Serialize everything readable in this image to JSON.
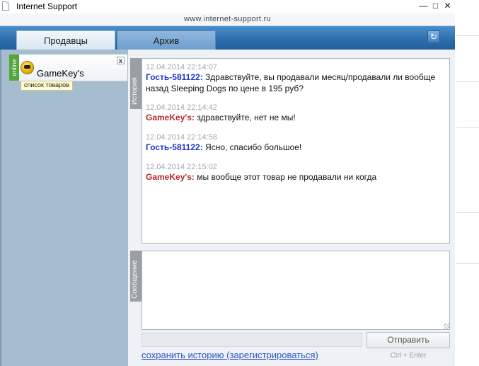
{
  "window": {
    "title": "Internet Support",
    "url": "www.internet-support.ru",
    "controls": {
      "minimize": "—",
      "maximize": "□",
      "close": "✕"
    }
  },
  "tabs": [
    {
      "label": "Продавцы",
      "active": true
    },
    {
      "label": "Архив",
      "active": false
    }
  ],
  "refresh_icon": "refresh-icon",
  "operator": {
    "status": "online",
    "name": "GameKey's",
    "products_link": "список товаров",
    "close_label": "x"
  },
  "history": {
    "label": "История",
    "messages": [
      {
        "time": "12.04.2014 22:14:07",
        "sender": "Гость-581122",
        "text": "Здравствуйте, вы продавали месяц/продавали ли вообще назад Sleeping Dogs по цене в 195 руб?",
        "role": "guest"
      },
      {
        "time": "12.04.2014 22:14:42",
        "sender": "GameKey's",
        "text": "здравствуйте, нет не мы!",
        "role": "operator"
      },
      {
        "time": "12.04.2014 22:14:58",
        "sender": "Гость-581122",
        "text": "Ясно, спасибо большое!",
        "role": "guest"
      },
      {
        "time": "12.04.2014 22:15:02",
        "sender": "GameKey's",
        "text": "мы вообще этот товар не продавали ни когда",
        "role": "operator"
      }
    ]
  },
  "compose": {
    "label": "Сообщение",
    "value": "",
    "send_label": "Отправить",
    "send_hint": "Ctrl + Enter"
  },
  "save_history_link": "сохранить историю (зарегистрироваться)",
  "colors": {
    "header": "#2f6fae",
    "online": "#53a63b",
    "guest_name": "#1e37c8",
    "operator_name": "#b5262c",
    "link": "#2b56c5"
  }
}
